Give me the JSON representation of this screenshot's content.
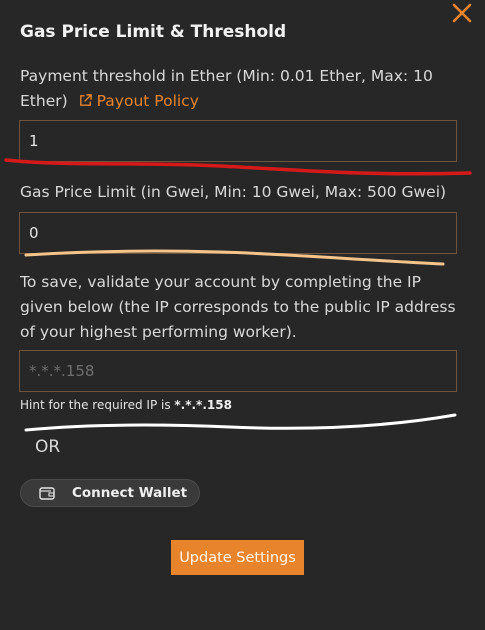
{
  "dialog": {
    "title": "Gas Price Limit & Threshold",
    "accent_color": "#e8842c"
  },
  "payment": {
    "label": "Payment threshold in Ether (Min: 0.01 Ether, Max: 10 Ether)",
    "link_label": "Payout Policy",
    "link_icon": "external-link-icon",
    "value": "1"
  },
  "gas": {
    "label": "Gas Price Limit (in Gwei, Min: 10 Gwei, Max: 500 Gwei)",
    "value": "0"
  },
  "validate": {
    "label": "To save, validate your account by completing the IP given below (the IP corresponds to the public IP address of your highest performing worker).",
    "placeholder": "*.*.*.158",
    "hint_prefix": "Hint for the required IP is ",
    "hint_ip": "*.*.*.158"
  },
  "or_label": "OR",
  "wallet": {
    "button_label": "Connect Wallet",
    "icon": "wallet-icon"
  },
  "update_button": "Update Settings",
  "annotations": {
    "red_line_color": "#d61a1a",
    "orange_line_color": "#f4c48a",
    "white_line_color": "#ffffff"
  }
}
